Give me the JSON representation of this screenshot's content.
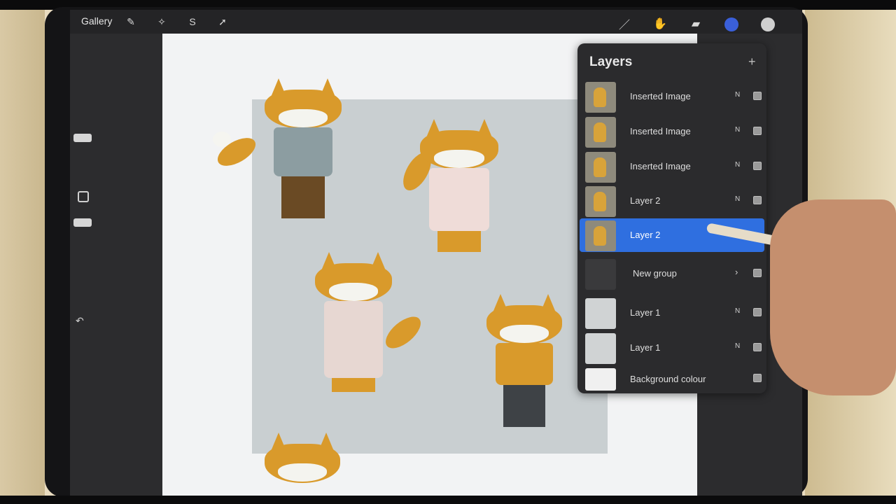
{
  "app": {
    "gallery_label": "Gallery",
    "tools_left": [
      "wrench-icon",
      "magic-wand-icon",
      "selection-icon",
      "transform-arrow-icon"
    ],
    "tools_right": [
      "brush-icon",
      "smudge-icon",
      "eraser-icon",
      "layers-icon"
    ],
    "current_color": "#3a5fd9"
  },
  "layers_panel": {
    "title": "Layers",
    "add_label": "+",
    "rows": [
      {
        "name": "Inserted Image",
        "blend": "N",
        "visible": true,
        "thumb": "image"
      },
      {
        "name": "Inserted Image",
        "blend": "N",
        "visible": true,
        "thumb": "image"
      },
      {
        "name": "Inserted Image",
        "blend": "N",
        "visible": true,
        "thumb": "image"
      },
      {
        "name": "Layer 2",
        "blend": "N",
        "visible": true,
        "thumb": "image"
      },
      {
        "name": "Layer 2",
        "blend": "",
        "visible": true,
        "thumb": "image",
        "selected": true
      },
      {
        "name": "New group",
        "blend": "",
        "visible": true,
        "thumb": "group",
        "chevron": "›"
      },
      {
        "name": "Layer 1",
        "blend": "N",
        "visible": true,
        "thumb": "plain"
      },
      {
        "name": "Layer 1",
        "blend": "N",
        "visible": true,
        "thumb": "plain"
      },
      {
        "name": "Background colour",
        "blend": "",
        "visible": true,
        "thumb": "bg"
      }
    ]
  }
}
